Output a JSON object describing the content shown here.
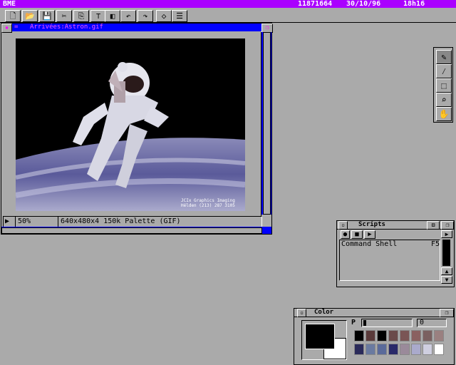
{
  "menubar": {
    "app": "BME",
    "memory": "11871664",
    "date": "30/10/96",
    "time": "18h16"
  },
  "toolbar": {
    "buttons": [
      {
        "name": "new-icon",
        "glyph": "🗋"
      },
      {
        "name": "open-icon",
        "glyph": "📂"
      },
      {
        "name": "save-icon",
        "glyph": "💾"
      },
      {
        "name": "cut-icon",
        "glyph": "✂"
      },
      {
        "name": "copy-icon",
        "glyph": "⎘"
      },
      {
        "name": "paste-icon",
        "glyph": "⊤"
      },
      {
        "name": "import-icon",
        "glyph": "◧"
      },
      {
        "name": "undo-icon",
        "glyph": "↶"
      },
      {
        "name": "redo-icon",
        "glyph": "↷"
      },
      {
        "name": "eraser-icon",
        "glyph": "◇"
      },
      {
        "name": "settings-icon",
        "glyph": "☰"
      }
    ]
  },
  "image_window": {
    "title": "Arrivées:Astron.gif",
    "zoom": "50%",
    "info": "640x480x4 150k Palette (GIF)",
    "credit_line1": "JCIx Graphics Imaging",
    "credit_line2": "Hélden (213) 287 3105"
  },
  "tools": [
    {
      "name": "pen-tool-icon",
      "glyph": "✎"
    },
    {
      "name": "eyedropper-tool-icon",
      "glyph": "⁄"
    },
    {
      "name": "selection-tool-icon",
      "glyph": "⬚"
    },
    {
      "name": "zoom-tool-icon",
      "glyph": "⌕"
    },
    {
      "name": "hand-tool-icon",
      "glyph": "✋"
    }
  ],
  "scripts": {
    "title": "Scripts",
    "items": [
      {
        "label": "Command Shell",
        "key": "F5"
      }
    ]
  },
  "color": {
    "title": "Color",
    "p_label": "P",
    "value": "0",
    "foreground": "#000000",
    "background": "#ffffff",
    "palette": [
      "#000000",
      "#5a3a3a",
      "#000000",
      "#6a4a4a",
      "#7a5555",
      "#8a6060",
      "#7a6060",
      "#9a8080",
      "#2a2a5a",
      "#6a7aa0",
      "#5a6a9a",
      "#2a2a6a",
      "#9a8a9a",
      "#aaaacc",
      "#cfcfe0",
      "#ffffff"
    ]
  }
}
